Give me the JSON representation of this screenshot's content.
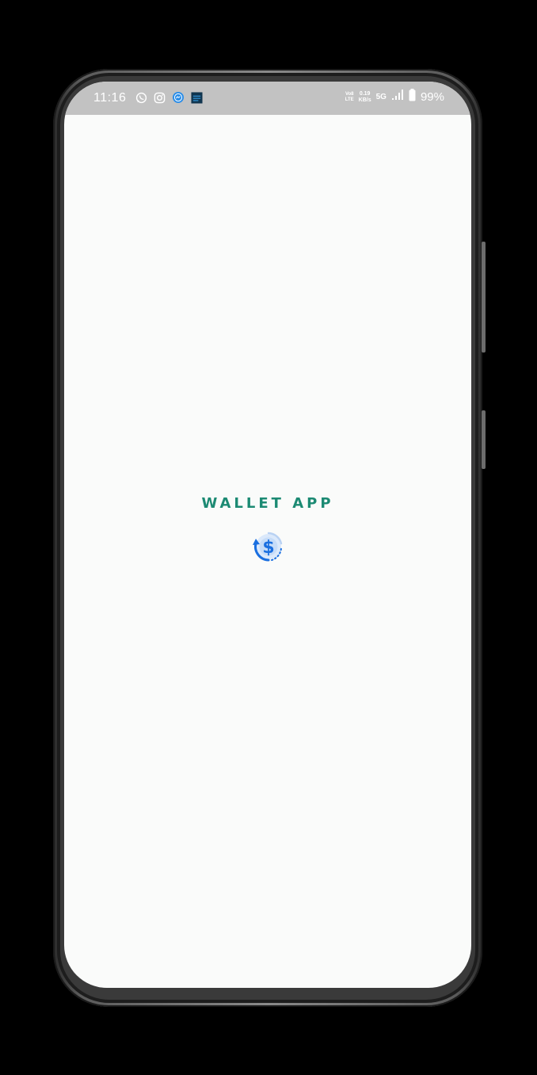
{
  "status_bar": {
    "time": "11:16",
    "icons_left": [
      "whatsapp-icon",
      "instagram-icon",
      "messenger-icon",
      "app-notification-icon"
    ],
    "volte_line1": "Vo8",
    "volte_line2": "LTE",
    "net_speed_value": "0.19",
    "net_speed_unit": "KB/s",
    "network_type": "5G",
    "battery_percent": "99%"
  },
  "splash": {
    "title": "WALLET APP",
    "logo_icon": "dollar-exchange-icon"
  },
  "colors": {
    "title": "#1c8a73",
    "logo_blue": "#1a6fe0",
    "logo_light": "#dbe9fb",
    "screen_bg": "#fafbfa",
    "status_bar_bg": "#c2c2c2"
  }
}
